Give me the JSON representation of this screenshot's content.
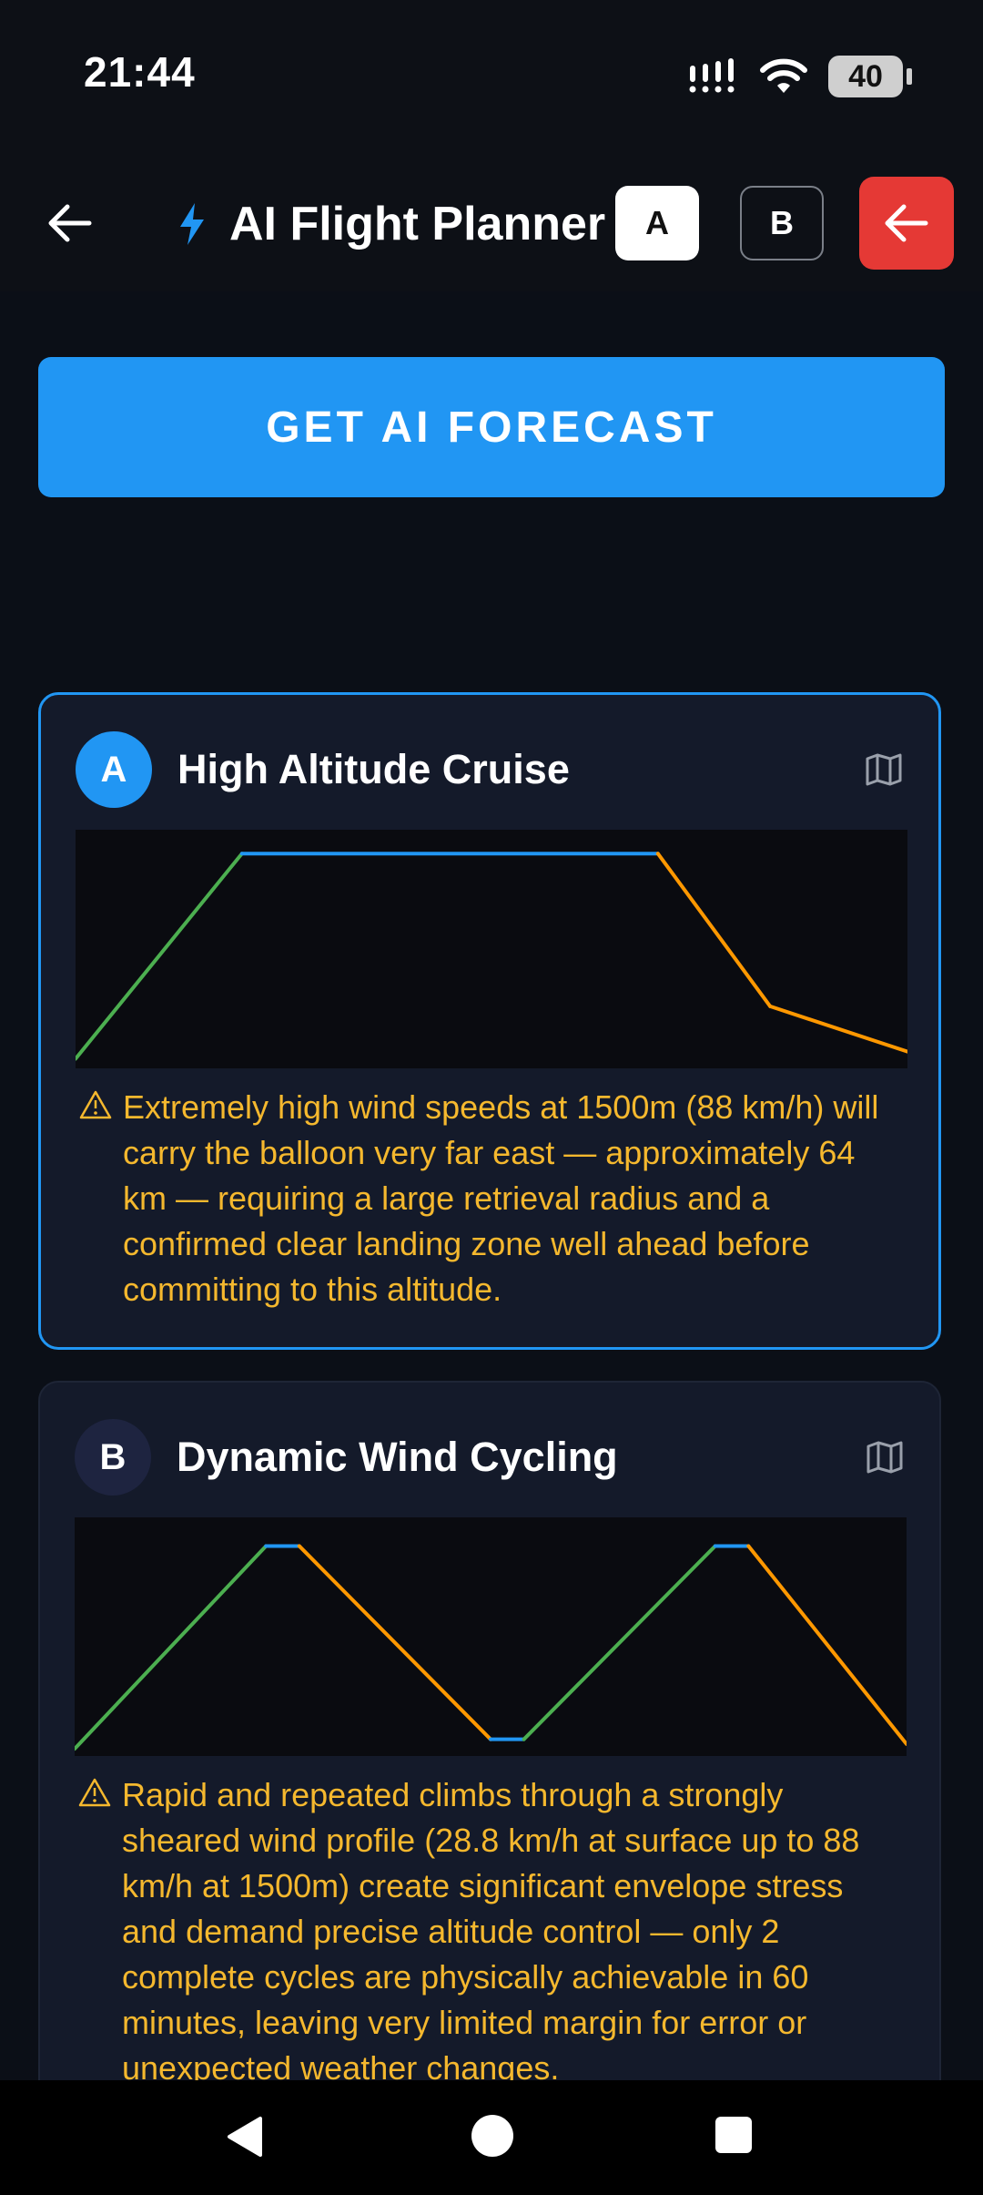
{
  "status_bar": {
    "time": "21:44",
    "battery": "40"
  },
  "app_bar": {
    "title": "AI Flight Planner",
    "option_a": "A",
    "option_b": "B"
  },
  "forecast_button": "GET AI FORECAST",
  "colors": {
    "accent": "#2196f3",
    "climb": "#4caf50",
    "cruise": "#2196f3",
    "descend": "#ff9800",
    "warning": "#f5b82e",
    "exit": "#e53935"
  },
  "plans": [
    {
      "badge": "A",
      "title": "High Altitude Cruise",
      "warning": "Extremely high wind speeds at 1500m (88 km/h) will carry the balloon very far east — approximately 64 km — requiring a large retrieval radius and a confirmed clear landing zone well ahead before committing to this altitude.",
      "profile": [
        {
          "t": 0,
          "alt": 0.04,
          "phase": "start"
        },
        {
          "t": 0.2,
          "alt": 0.9,
          "phase": "climb"
        },
        {
          "t": 0.7,
          "alt": 0.9,
          "phase": "cruise"
        },
        {
          "t": 0.835,
          "alt": 0.26,
          "phase": "descend"
        },
        {
          "t": 1.0,
          "alt": 0.07,
          "phase": "descend"
        }
      ]
    },
    {
      "badge": "B",
      "title": "Dynamic Wind Cycling",
      "warning": "Rapid and repeated climbs through a strongly sheared wind profile (28.8 km/h at surface up to 88 km/h at 1500m) create significant envelope stress and demand precise altitude control — only 2 complete cycles are physically achievable in 60 minutes, leaving very limited margin for error or unexpected weather changes.",
      "profile": [
        {
          "t": 0,
          "alt": 0.03,
          "phase": "start"
        },
        {
          "t": 0.23,
          "alt": 0.88,
          "phase": "climb"
        },
        {
          "t": 0.27,
          "alt": 0.88,
          "phase": "cruise"
        },
        {
          "t": 0.5,
          "alt": 0.07,
          "phase": "descend"
        },
        {
          "t": 0.54,
          "alt": 0.07,
          "phase": "cruise"
        },
        {
          "t": 0.77,
          "alt": 0.88,
          "phase": "climb"
        },
        {
          "t": 0.81,
          "alt": 0.88,
          "phase": "cruise"
        },
        {
          "t": 1.0,
          "alt": 0.05,
          "phase": "descend"
        }
      ]
    }
  ]
}
